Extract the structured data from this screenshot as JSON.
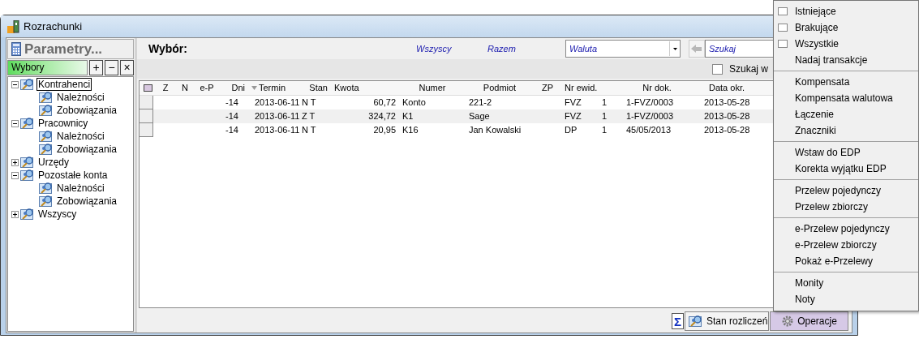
{
  "window": {
    "title": "Rozrachunki"
  },
  "sidebar": {
    "header": "Parametry...",
    "panel_label": "Wybory",
    "panel_buttons": [
      "+",
      "−",
      "×"
    ],
    "tree": [
      {
        "label": "Kontrahenci",
        "expanded": true,
        "selected": true,
        "children": [
          {
            "label": "Należności",
            "selected": false
          },
          {
            "label": "Zobowiązania",
            "selected": false
          }
        ]
      },
      {
        "label": "Pracownicy",
        "expanded": true,
        "selected": false,
        "children": [
          {
            "label": "Należności",
            "selected": false
          },
          {
            "label": "Zobowiązania",
            "selected": false
          }
        ]
      },
      {
        "label": "Urzędy",
        "expanded": false,
        "selected": false
      },
      {
        "label": "Pozostałe konta",
        "expanded": true,
        "selected": false,
        "children": [
          {
            "label": "Należności",
            "selected": false
          },
          {
            "label": "Zobowiązania",
            "selected": false
          }
        ]
      },
      {
        "label": "Wszyscy",
        "expanded": false,
        "selected": false
      }
    ]
  },
  "toolbar": {
    "title": "Wybór:",
    "links": [
      "Wszyscy",
      "Razem"
    ],
    "currency": {
      "value": "Waluta"
    },
    "search": {
      "placeholder": "Szukaj"
    },
    "search_in": {
      "label": "Szukaj w",
      "checked": false
    }
  },
  "table": {
    "columns": [
      "Z",
      "N",
      "e-P",
      "Dni",
      "Termin",
      "Stan",
      "Kwota",
      "Numer",
      "Podmiot",
      "ZP",
      "Nr ewid.",
      "Nr dok.",
      "Data okr."
    ],
    "rows": [
      {
        "dni": "-14",
        "termin": "2013-06-11",
        "stan": "N T",
        "kwota": "60,72",
        "numer": "Konto",
        "podmiot": "221-2",
        "nr_ewid": "FVZ",
        "column_13": "1",
        "nr_dok": "1-FVZ/0003",
        "data_okr": "2013-05-28"
      },
      {
        "dni": "-14",
        "termin": "2013-06-11",
        "stan": "Z T",
        "kwota": "324,72",
        "numer": "K1",
        "podmiot": "Sage",
        "nr_ewid": "FVZ",
        "column_13": "1",
        "nr_dok": "1-FVZ/0003",
        "data_okr": "2013-05-28"
      },
      {
        "dni": "-14",
        "termin": "2013-06-11",
        "stan": "N T",
        "kwota": "20,95",
        "numer": "K16",
        "podmiot": "Jan Kowalski",
        "nr_ewid": "DP",
        "column_13": "1",
        "nr_dok": "45/05/2013",
        "data_okr": "2013-05-28"
      }
    ]
  },
  "bottom_bar": {
    "sum_button": "Σ",
    "buttons": [
      {
        "label": "Stan rozliczeń",
        "selected": false
      },
      {
        "label": "Operacje",
        "selected": true
      }
    ]
  },
  "menu": [
    {
      "kind": "check",
      "label": "Istniejące",
      "checked": false
    },
    {
      "kind": "check",
      "label": "Brakujące",
      "checked": false
    },
    {
      "kind": "check",
      "label": "Wszystkie",
      "checked": false
    },
    {
      "kind": "item",
      "label": "Nadaj transakcje"
    },
    {
      "kind": "separator"
    },
    {
      "kind": "item",
      "label": "Kompensata"
    },
    {
      "kind": "item",
      "label": "Kompensata walutowa"
    },
    {
      "kind": "item",
      "label": "Łączenie"
    },
    {
      "kind": "item",
      "label": "Znaczniki"
    },
    {
      "kind": "separator"
    },
    {
      "kind": "item",
      "label": "Wstaw do EDP"
    },
    {
      "kind": "item",
      "label": "Korekta wyjątku EDP"
    },
    {
      "kind": "separator"
    },
    {
      "kind": "item",
      "label": "Przelew pojedynczy"
    },
    {
      "kind": "item",
      "label": "Przelew zbiorczy"
    },
    {
      "kind": "separator"
    },
    {
      "kind": "item",
      "label": "e-Przelew pojedynczy"
    },
    {
      "kind": "item",
      "label": "e-Przelew zbiorczy"
    },
    {
      "kind": "item",
      "label": "Pokaż e-Przelewy"
    },
    {
      "kind": "separator"
    },
    {
      "kind": "item",
      "label": "Monity"
    },
    {
      "kind": "item",
      "label": "Noty"
    }
  ]
}
